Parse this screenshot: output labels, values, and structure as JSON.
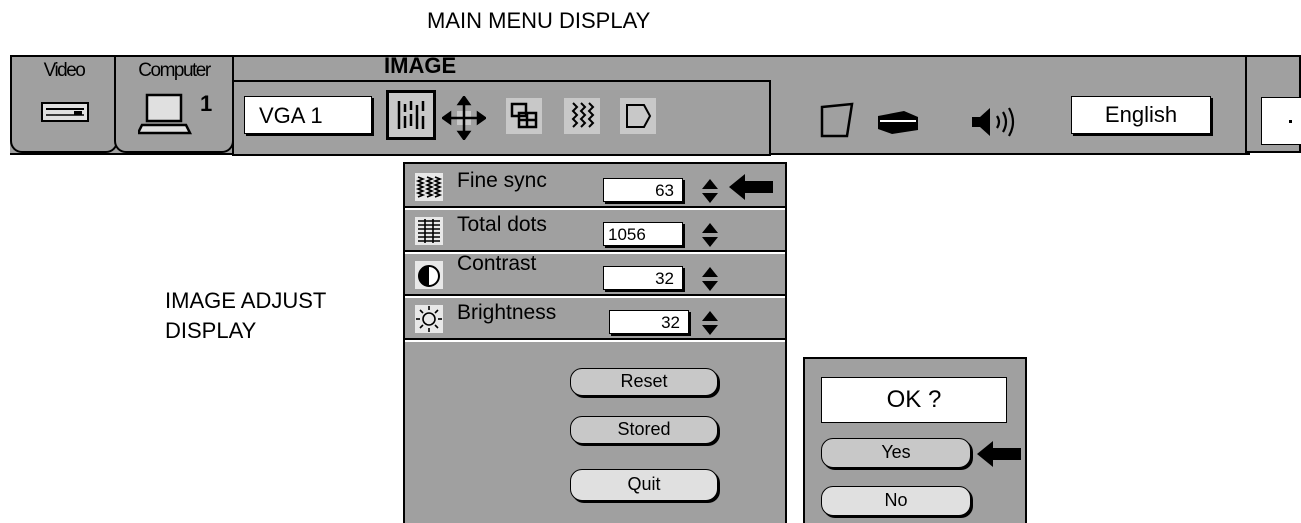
{
  "captions": {
    "main_menu": "MAIN MENU DISPLAY",
    "image_adjust_line1": "IMAGE ADJUST",
    "image_adjust_line2": "DISPLAY"
  },
  "menubar": {
    "tabs": [
      {
        "label": "Video",
        "icon": "vcr-icon"
      },
      {
        "label": "Computer",
        "icon": "laptop-icon",
        "badge": "1"
      }
    ],
    "section_title": "IMAGE",
    "source_field": "VGA 1",
    "image_icons": [
      "fine-sync-icon",
      "position-icon",
      "pc-adjust-icon",
      "image-level-icon",
      "screen-icon"
    ],
    "right_icons": [
      "screen-icon",
      "lamp-icon",
      "sound-icon"
    ],
    "language": "English",
    "exit_icon": "exit-door-icon"
  },
  "adjust_panel": {
    "rows": [
      {
        "label": "Fine sync",
        "value": "63",
        "icon": "fine-sync-icon"
      },
      {
        "label": "Total dots",
        "value": "1056",
        "icon": "total-dots-icon"
      },
      {
        "label": "Contrast",
        "value": "32",
        "icon": "contrast-icon"
      },
      {
        "label": "Brightness",
        "value": "32",
        "icon": "brightness-icon"
      }
    ],
    "buttons": {
      "reset": "Reset",
      "stored": "Stored",
      "quit": "Quit"
    }
  },
  "confirm_dialog": {
    "prompt": "OK ?",
    "yes": "Yes",
    "no": "No"
  }
}
